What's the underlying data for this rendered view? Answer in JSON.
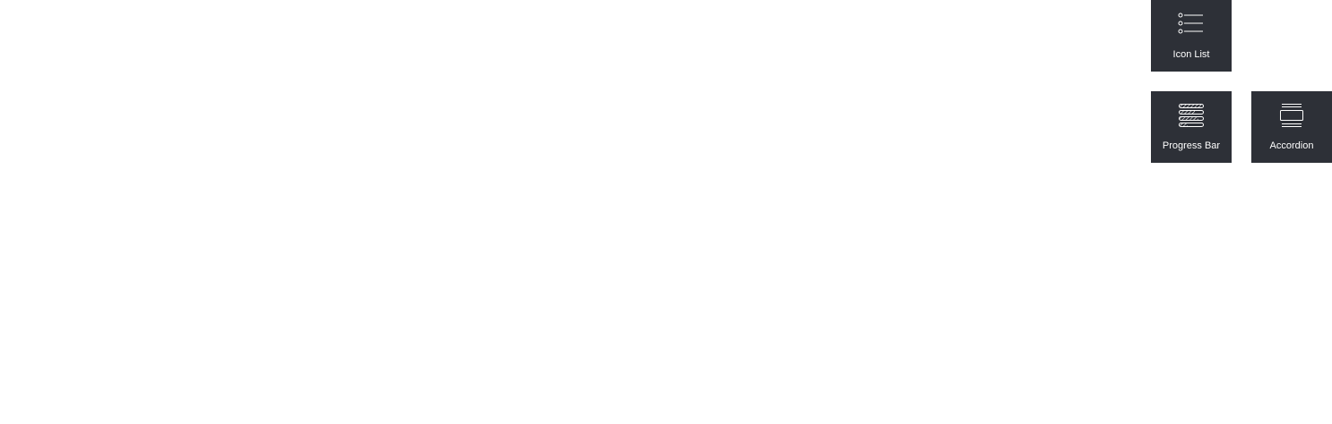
{
  "widgets": [
    {
      "label": "Icon List",
      "icon": "icon-list-icon"
    },
    {
      "label": "Progress Bar",
      "icon": "progress-bar-icon"
    },
    {
      "label": "Accordion",
      "icon": "accordion-icon"
    }
  ],
  "colors": {
    "tile_background": "#2d3037",
    "tile_foreground": "#ffffff",
    "page_background": "#ffffff"
  }
}
